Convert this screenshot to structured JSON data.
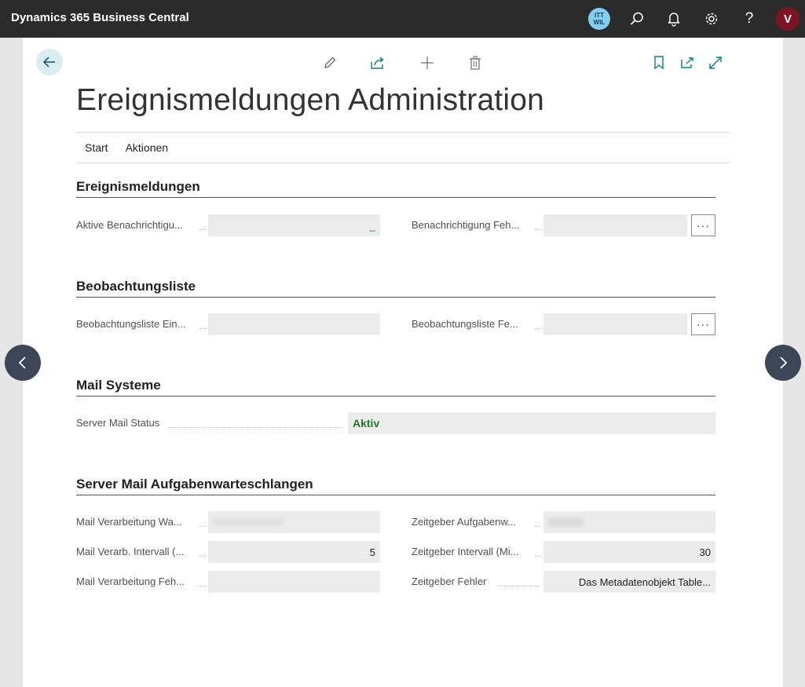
{
  "app": {
    "title": "Dynamics 365 Business Central"
  },
  "topbar": {
    "company_line1": "ITT",
    "company_line2": "WIL",
    "user_initial": "V",
    "help_glyph": "?",
    "icons": [
      "company-badge",
      "search-icon",
      "bell-icon",
      "gear-icon",
      "help-icon",
      "avatar"
    ]
  },
  "page": {
    "title": "Ereignismeldungen Administration",
    "action_icons": [
      "edit-icon",
      "share-icon",
      "add-icon",
      "delete-icon",
      "bookmark-icon",
      "open-new-window-icon",
      "expand-icon"
    ],
    "menu": [
      "Start",
      "Aktionen"
    ]
  },
  "sections": {
    "ereignis": {
      "title": "Ereignismeldungen",
      "field1_label": "Aktive Benachrichtigu...",
      "field1_value": "_",
      "field2_label": "Benachrichtigung Feh...",
      "field2_value": "",
      "lookup": "···"
    },
    "beobachtung": {
      "title": "Beobachtungsliste",
      "field1_label": "Beobachtungsliste Ein...",
      "field1_value": "",
      "field2_label": "Beobachtungsliste Fe...",
      "field2_value": "",
      "lookup": "···"
    },
    "mail": {
      "title": "Mail Systeme",
      "field1_label": "Server Mail Status",
      "field1_value": "Aktiv"
    },
    "queue": {
      "title": "Server Mail Aufgabenwarteschlangen",
      "row1_label_left": "Mail Verarbeitung Wa...",
      "row1_value_left": "",
      "row1_label_right": "Zeitgeber Aufgabenw...",
      "row1_value_right": "",
      "row2_label_left": "Mail Verarb. Intervall (...",
      "row2_value_left": "5",
      "row2_label_right": "Zeitgeber Intervall (Mi...",
      "row2_value_right": "30",
      "row3_label_left": "Mail Verarbeitung Feh...",
      "row3_value_left": "",
      "row3_label_right": "Zeitgeber Fehler",
      "row3_value_right": "Das Metadatenobjekt Table..."
    }
  },
  "colors": {
    "accent": "#00838a",
    "topbar": "#2b2b2b",
    "status_ok": "#1e7d22",
    "avatar": "#7c1421"
  }
}
